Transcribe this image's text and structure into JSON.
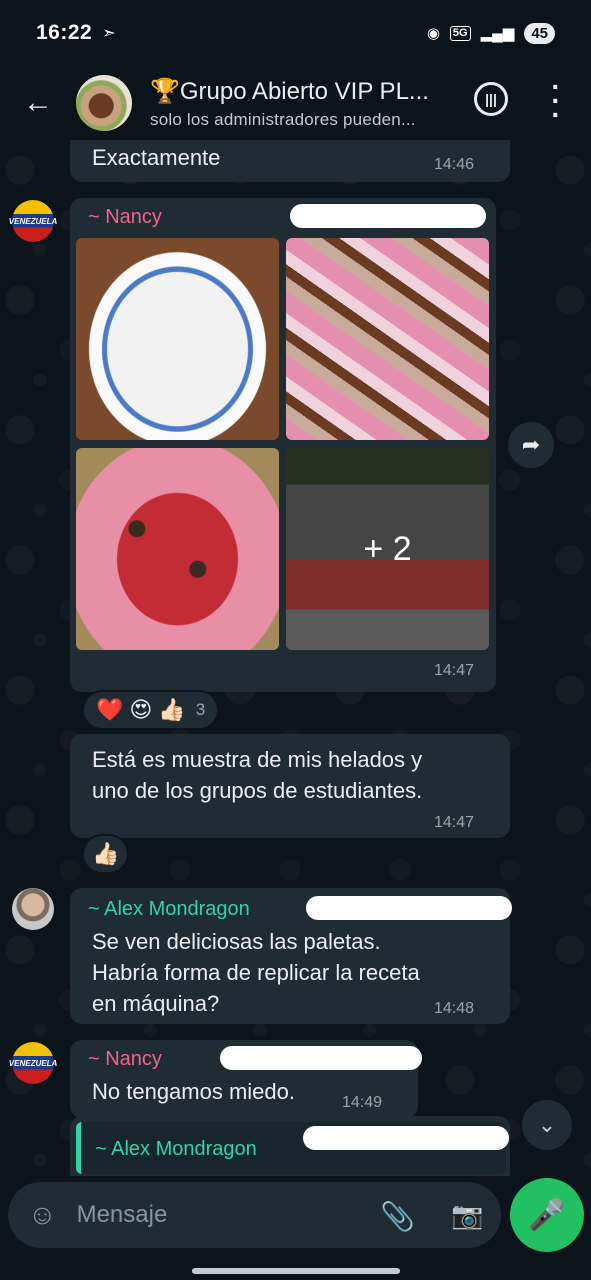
{
  "status_bar": {
    "time": "16:22",
    "network": "5G",
    "battery": "45"
  },
  "header": {
    "title": "🏆Grupo Abierto VIP PL...",
    "subtitle": "solo los administradores pueden..."
  },
  "messages": [
    {
      "text": "Exactamente",
      "time": "14:46"
    },
    {
      "sender": "~ Nancy",
      "type": "album",
      "more_count": "+ 2",
      "time": "14:47",
      "reactions": [
        "❤️",
        "😍",
        "👍🏻"
      ],
      "reaction_count": "3"
    },
    {
      "text_line1": "Está es muestra de mis helados y",
      "text_line2": "uno de los grupos de estudiantes.",
      "time": "14:47",
      "reaction": "👍🏻"
    },
    {
      "sender": "~ Alex Mondragon",
      "text_line1": "Se ven deliciosas las paletas.",
      "text_line2": "Habría forma de replicar la receta",
      "text_line3": "en máquina?",
      "time": "14:48"
    },
    {
      "sender": "~ Nancy",
      "text": "No tengamos miedo.",
      "time": "14:49"
    },
    {
      "sender": "~ Alex Mondragon",
      "type": "reply"
    }
  ],
  "composer": {
    "placeholder": "Mensaje"
  },
  "colors": {
    "background": "#0b141a",
    "bubble": "#1f2c34",
    "nancy_name": "#f1648e",
    "alex_name": "#35d2a2",
    "mic_button": "#21c063"
  },
  "icons": [
    "back-arrow-icon",
    "voice-chat-icon",
    "menu-icon",
    "forward-icon",
    "chevron-down-icon",
    "emoji-icon",
    "attach-icon",
    "camera-icon",
    "mic-icon"
  ]
}
